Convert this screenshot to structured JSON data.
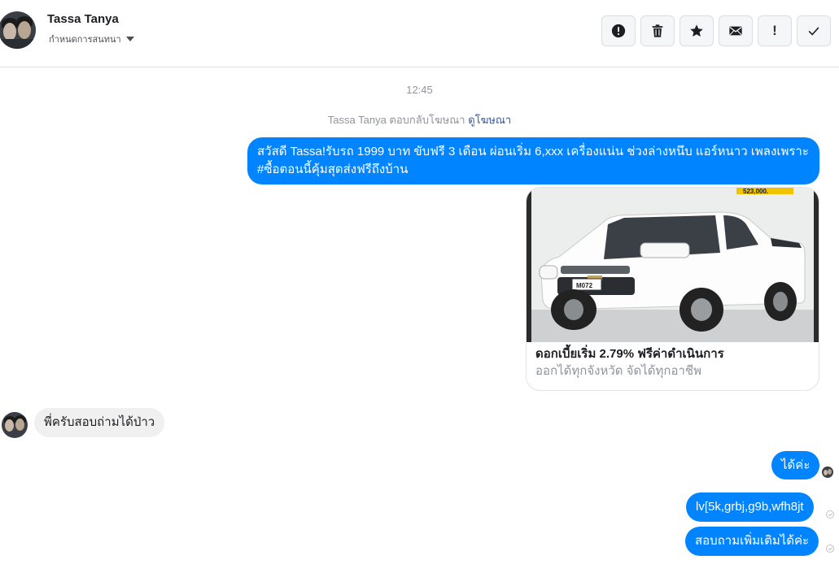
{
  "header": {
    "contact_name": "Tassa Tanya",
    "settings_label": "กำหนดการสนทนา",
    "toolbar": [
      {
        "name": "report-button",
        "icon": "alert-circle-icon"
      },
      {
        "name": "delete-button",
        "icon": "trash-icon"
      },
      {
        "name": "star-button",
        "icon": "star-icon"
      },
      {
        "name": "mark-unread-button",
        "icon": "envelope-icon"
      },
      {
        "name": "important-button",
        "icon": "exclamation-icon"
      },
      {
        "name": "mark-done-button",
        "icon": "check-icon"
      }
    ]
  },
  "conversation": {
    "timestamp": "12:45",
    "ad_note": {
      "text": "Tassa Tanya ตอบกลับโฆษณา",
      "link": "ดูโฆษณา"
    },
    "messages": [
      {
        "side": "out",
        "text": "สวัสดี Tassa!รับรถ 1999 บาท ขับฟรี 3 เดือน ผ่อนเริ่ม 6,xxx   เครื่องแน่น ช่วงล่างหนึบ แอร์หนาว เพลงเพราะ #ซื้อตอนนี้คุ้มสุดส่งฟรีถึงบ้าน"
      },
      {
        "side": "in",
        "text": "พี่ครับสอบถ่ามได้ป่าว"
      },
      {
        "side": "out",
        "text": "ได้ค่ะ"
      },
      {
        "side": "out",
        "text": "lv[5k,grbj,g9b,wfh8jt"
      },
      {
        "side": "out",
        "text": "สอบถามเพิ่มเติมได้ค่ะ"
      }
    ],
    "ad_card": {
      "title": "ดอกเบี้ยเริ่ม 2.79% ฟรีค่าดำเนินการ",
      "subtitle": "ออกได้ทุกจังหวัด จัดได้ทุกอาชีพ",
      "plate": "M072",
      "price_tag": "523,000."
    }
  },
  "colors": {
    "outgoing_bubble": "#0084ff",
    "incoming_bubble": "#f1f0f0",
    "link": "#385898",
    "meta_text": "#90949c"
  }
}
